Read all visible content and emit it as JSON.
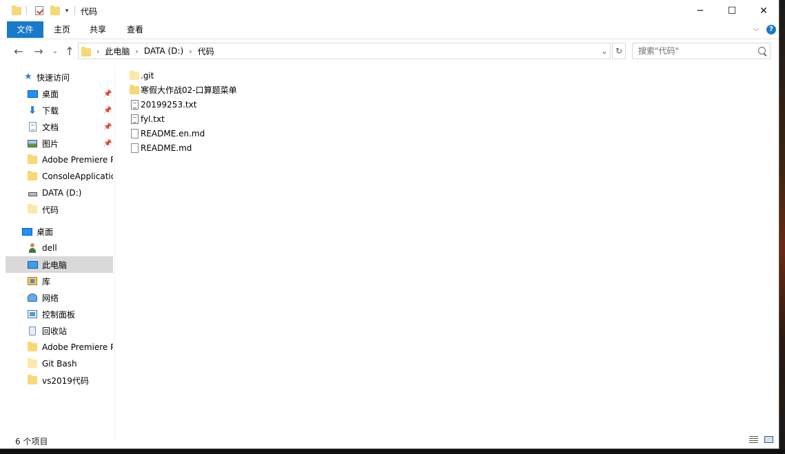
{
  "window": {
    "title": "代码",
    "controls": {
      "minimize": "─",
      "maximize": "☐",
      "close": "✕"
    }
  },
  "quick_access_toolbar": {
    "icons": [
      "folder-icon",
      "properties-icon",
      "new-folder-icon",
      "customize-dropdown-icon"
    ]
  },
  "ribbon": {
    "tabs": [
      "文件",
      "主页",
      "共享",
      "查看"
    ],
    "expand_glyph": "⌵",
    "help_glyph": "?"
  },
  "address_bar": {
    "breadcrumb": [
      "此电脑",
      "DATA (D:)",
      "代码"
    ],
    "search_placeholder": "搜索\"代码\""
  },
  "nav_pane": {
    "quick_access_label": "快速访问",
    "quick_access": [
      {
        "label": "桌面",
        "icon": "desktop-icon",
        "pinned": true
      },
      {
        "label": "下载",
        "icon": "download-icon",
        "pinned": true
      },
      {
        "label": "文档",
        "icon": "documents-icon",
        "pinned": true
      },
      {
        "label": "图片",
        "icon": "pictures-icon",
        "pinned": true
      },
      {
        "label": "Adobe Premiere Pro",
        "icon": "folder-icon",
        "pinned": false
      },
      {
        "label": "ConsoleApplication",
        "icon": "folder-icon",
        "pinned": false
      },
      {
        "label": "DATA (D:)",
        "icon": "drive-icon",
        "pinned": false
      },
      {
        "label": "代码",
        "icon": "folder-icon",
        "pinned": false
      }
    ],
    "desktop_label": "桌面",
    "desktop_items": [
      {
        "label": "dell",
        "icon": "user-icon",
        "selected": false
      },
      {
        "label": "此电脑",
        "icon": "this-pc-icon",
        "selected": true
      },
      {
        "label": "库",
        "icon": "library-icon",
        "selected": false
      },
      {
        "label": "网络",
        "icon": "network-icon",
        "selected": false
      },
      {
        "label": "控制面板",
        "icon": "control-panel-icon",
        "selected": false
      },
      {
        "label": "回收站",
        "icon": "recycle-bin-icon",
        "selected": false
      },
      {
        "label": "Adobe Premiere Pro",
        "icon": "folder-icon",
        "selected": false
      },
      {
        "label": "Git Bash",
        "icon": "folder-icon",
        "selected": false
      },
      {
        "label": "vs2019代码",
        "icon": "folder-icon",
        "selected": false
      }
    ]
  },
  "files": [
    {
      "name": ".git",
      "type": "folder-light"
    },
    {
      "name": "寒假大作战02-口算题菜单",
      "type": "folder"
    },
    {
      "name": "20199253.txt",
      "type": "txt"
    },
    {
      "name": "fyl.txt",
      "type": "txt"
    },
    {
      "name": "README.en.md",
      "type": "md"
    },
    {
      "name": "README.md",
      "type": "md"
    }
  ],
  "status_bar": {
    "item_count": "6 个项目",
    "view_buttons": [
      "details-view-icon",
      "large-icons-view-icon"
    ]
  },
  "colors": {
    "accent": "#1979ca",
    "selection": "#d9d9d9",
    "folder": "#f8d775"
  }
}
